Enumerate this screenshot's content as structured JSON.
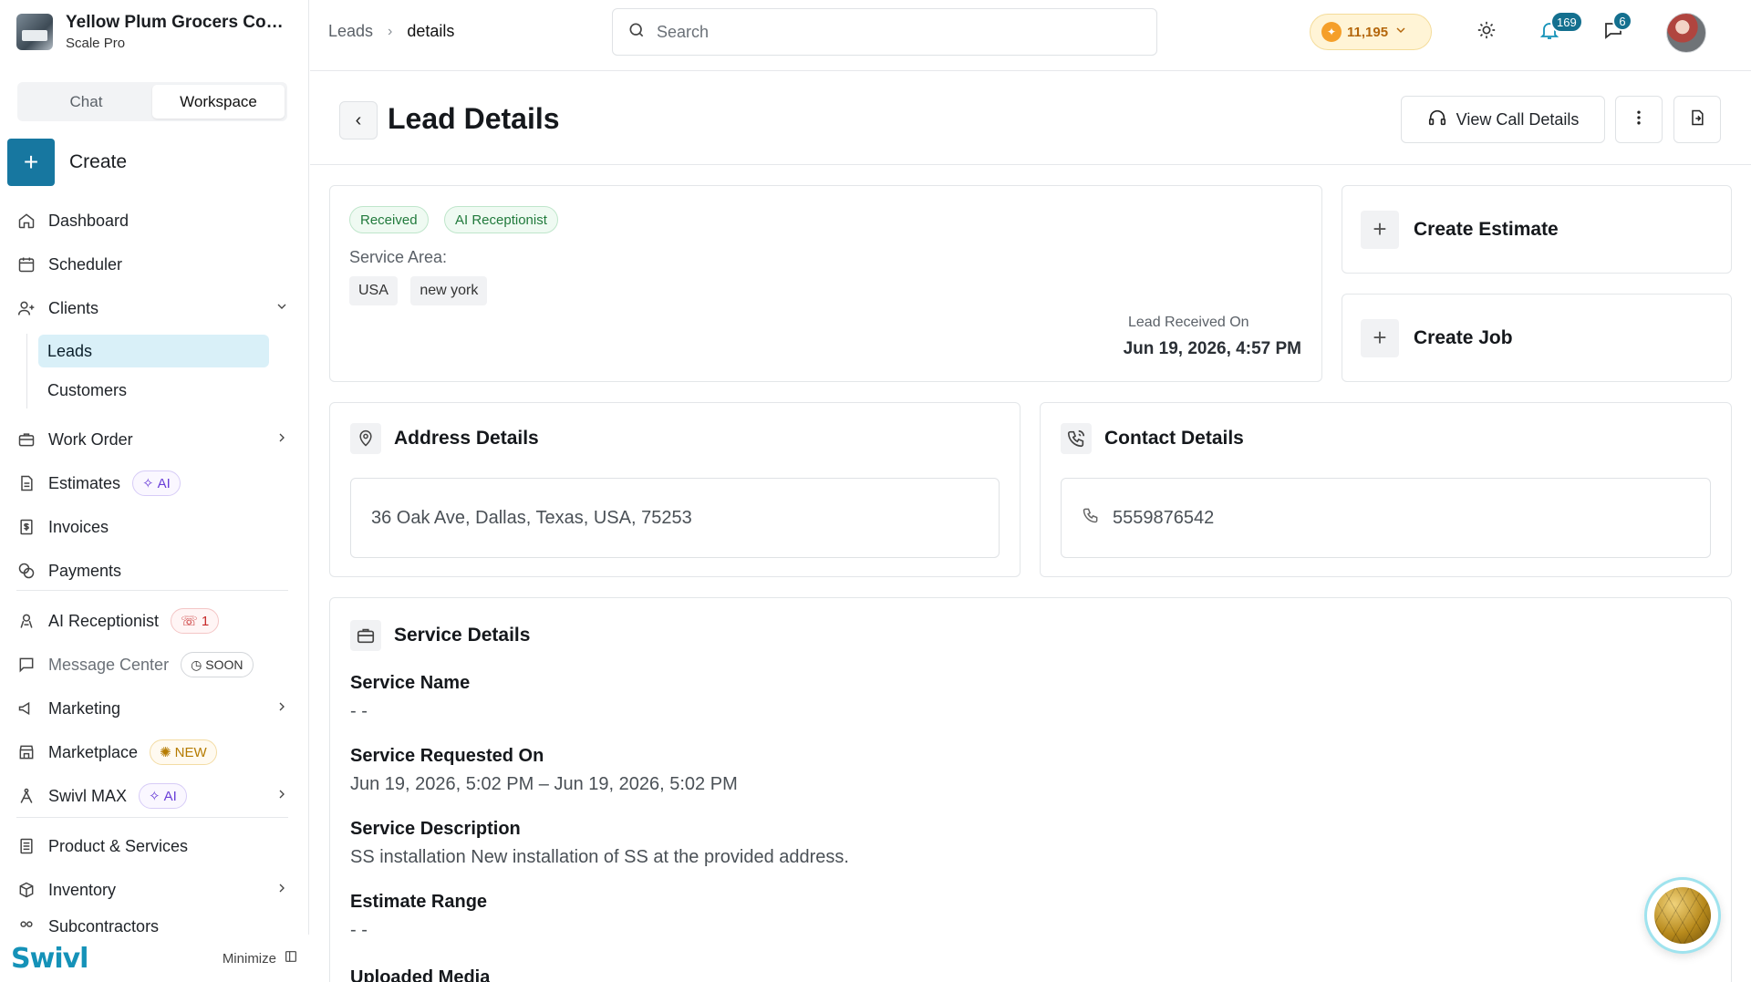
{
  "org": {
    "name": "Yellow Plum Grocers Com...",
    "plan": "Scale Pro"
  },
  "mode": {
    "chat": "Chat",
    "workspace": "Workspace"
  },
  "create": {
    "label": "Create"
  },
  "nav": {
    "dashboard": "Dashboard",
    "scheduler": "Scheduler",
    "clients": "Clients",
    "leads": "Leads",
    "customers": "Customers",
    "work_order": "Work Order",
    "estimates": "Estimates",
    "estimates_badge": "AI",
    "invoices": "Invoices",
    "payments": "Payments",
    "ai_receptionist": "AI Receptionist",
    "ai_receptionist_badge": "1",
    "message_center": "Message Center",
    "message_center_badge": "SOON",
    "marketing": "Marketing",
    "marketplace": "Marketplace",
    "marketplace_badge": "NEW",
    "swivl_max": "Swivl MAX",
    "swivl_max_badge": "AI",
    "product_services": "Product & Services",
    "inventory": "Inventory",
    "subcontractors": "Subcontractors"
  },
  "footer": {
    "brand": "Swivl",
    "minimize": "Minimize"
  },
  "topbar": {
    "breadcrumb_1": "Leads",
    "breadcrumb_2": "details",
    "search_placeholder": "Search",
    "coins": "11,195",
    "notifications_count": "169",
    "messages_count": "6"
  },
  "page": {
    "title": "Lead Details",
    "view_call_details": "View Call Details"
  },
  "lead": {
    "status": "Received",
    "source": "AI Receptionist",
    "service_area_label": "Service Area:",
    "area_1": "USA",
    "area_2": "new york",
    "received_label": "Lead Received On",
    "received_value": "Jun 19, 2026, 4:57 PM"
  },
  "actions": {
    "create_estimate": "Create Estimate",
    "create_job": "Create Job"
  },
  "address": {
    "title": "Address Details",
    "value": "36 Oak Ave, Dallas, Texas, USA, 75253"
  },
  "contact": {
    "title": "Contact Details",
    "phone": "5559876542"
  },
  "service": {
    "title": "Service Details",
    "name_label": "Service Name",
    "name_value": "- -",
    "requested_label": "Service Requested On",
    "requested_value": "Jun 19, 2026, 5:02 PM – Jun 19, 2026, 5:02 PM",
    "description_label": "Service Description",
    "description_value": "SS installation New installation of SS at the provided address.",
    "estimate_label": "Estimate Range",
    "estimate_value": "- -",
    "media_label": "Uploaded Media"
  },
  "colors": {
    "accent": "#1777a0",
    "active_nav": "#d9f0f8",
    "success": "#217a3c"
  }
}
